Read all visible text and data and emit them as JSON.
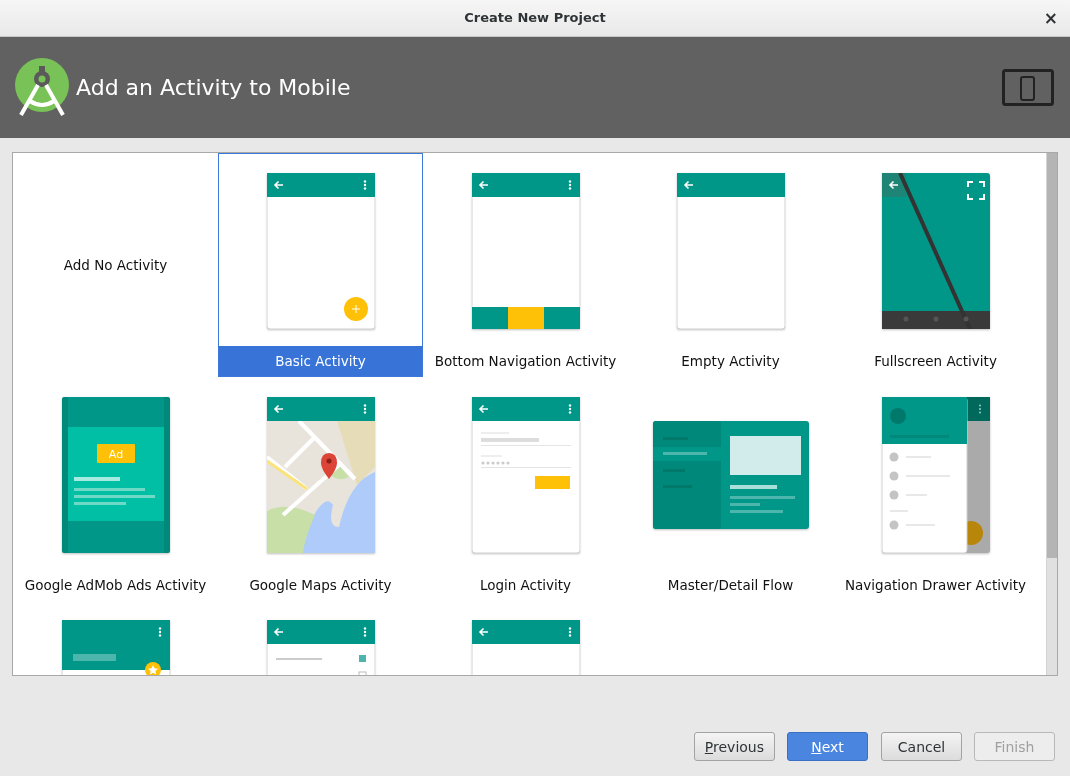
{
  "window": {
    "title": "Create New Project",
    "close": "×"
  },
  "header": {
    "title": "Add an Activity to Mobile"
  },
  "gallery": {
    "items": [
      {
        "label": "Add No Activity",
        "kind": "none",
        "selected": false
      },
      {
        "label": "Basic Activity",
        "kind": "fab",
        "selected": true
      },
      {
        "label": "Bottom Navigation Activity",
        "kind": "bottom-bar",
        "selected": false
      },
      {
        "label": "Empty Activity",
        "kind": "plain",
        "selected": false
      },
      {
        "label": "Fullscreen Activity",
        "kind": "fullscreen",
        "selected": false
      },
      {
        "label": "Google AdMob Ads Activity",
        "kind": "ad",
        "selected": false,
        "preview_text": "Ad"
      },
      {
        "label": "Google Maps Activity",
        "kind": "map",
        "selected": false
      },
      {
        "label": "Login Activity",
        "kind": "form",
        "selected": false
      },
      {
        "label": "Master/Detail Flow",
        "kind": "split",
        "selected": false
      },
      {
        "label": "Navigation Drawer Activity",
        "kind": "drawer",
        "selected": false
      },
      {
        "kind": "collapsing",
        "selected": false
      },
      {
        "kind": "checklist",
        "selected": false
      },
      {
        "kind": "menu",
        "selected": false
      }
    ]
  },
  "buttons": [
    {
      "label": "Previous",
      "mnemonic": true,
      "primary": false,
      "disabled": false
    },
    {
      "label": "Next",
      "mnemonic": true,
      "primary": true,
      "disabled": false
    },
    {
      "label": "Cancel",
      "mnemonic": false,
      "primary": false,
      "disabled": false
    },
    {
      "label": "Finish",
      "mnemonic": false,
      "primary": false,
      "disabled": true
    }
  ]
}
